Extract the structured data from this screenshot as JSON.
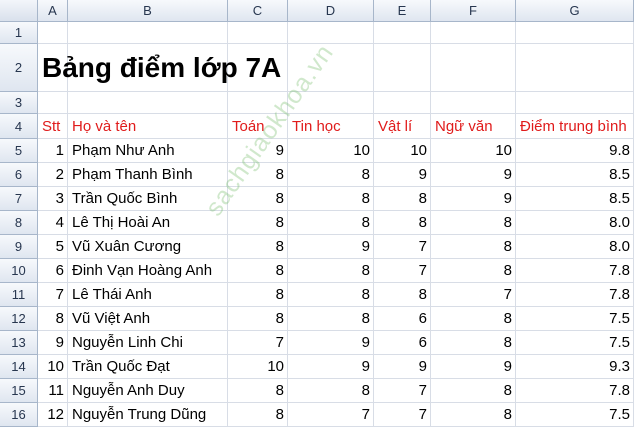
{
  "columns": [
    "A",
    "B",
    "C",
    "D",
    "E",
    "F",
    "G"
  ],
  "rows": [
    "1",
    "2",
    "3",
    "4",
    "5",
    "6",
    "7",
    "8",
    "9",
    "10",
    "11",
    "12",
    "13",
    "14",
    "15",
    "16"
  ],
  "title": "Bảng điểm lớp 7A",
  "headers": [
    "Stt",
    "Họ và tên",
    "Toán",
    "Tin học",
    "Vật lí",
    "Ngữ văn",
    "Điểm trung bình"
  ],
  "students": [
    {
      "stt": "1",
      "name": "Phạm Như Anh",
      "toan": "9",
      "tin": "10",
      "ly": "10",
      "van": "10",
      "tb": "9.8"
    },
    {
      "stt": "2",
      "name": "Phạm Thanh Bình",
      "toan": "8",
      "tin": "8",
      "ly": "9",
      "van": "9",
      "tb": "8.5"
    },
    {
      "stt": "3",
      "name": "Trần Quốc Bình",
      "toan": "8",
      "tin": "8",
      "ly": "8",
      "van": "9",
      "tb": "8.5"
    },
    {
      "stt": "4",
      "name": "Lê Thị Hoài An",
      "toan": "8",
      "tin": "8",
      "ly": "8",
      "van": "8",
      "tb": "8.0"
    },
    {
      "stt": "5",
      "name": "Vũ Xuân Cương",
      "toan": "8",
      "tin": "9",
      "ly": "7",
      "van": "8",
      "tb": "8.0"
    },
    {
      "stt": "6",
      "name": "Đinh Vạn Hoàng Anh",
      "toan": "8",
      "tin": "8",
      "ly": "7",
      "van": "8",
      "tb": "7.8"
    },
    {
      "stt": "7",
      "name": "Lê Thái Anh",
      "toan": "8",
      "tin": "8",
      "ly": "8",
      "van": "7",
      "tb": "7.8"
    },
    {
      "stt": "8",
      "name": "Vũ Việt Anh",
      "toan": "8",
      "tin": "8",
      "ly": "6",
      "van": "8",
      "tb": "7.5"
    },
    {
      "stt": "9",
      "name": "Nguyễn Linh Chi",
      "toan": "7",
      "tin": "9",
      "ly": "6",
      "van": "8",
      "tb": "7.5"
    },
    {
      "stt": "10",
      "name": "Trần Quốc Đạt",
      "toan": "10",
      "tin": "9",
      "ly": "9",
      "van": "9",
      "tb": "9.3"
    },
    {
      "stt": "11",
      "name": "Nguyễn Anh Duy",
      "toan": "8",
      "tin": "8",
      "ly": "7",
      "van": "8",
      "tb": "7.8"
    },
    {
      "stt": "12",
      "name": "Nguyễn Trung Dũng",
      "toan": "8",
      "tin": "7",
      "ly": "7",
      "van": "8",
      "tb": "7.5"
    }
  ],
  "watermark": "sachgiaokhoa.vn",
  "colors": {
    "header_text": "#e01b1b",
    "header_bg": "#dfe6f0",
    "grid": "#d8dde6"
  }
}
